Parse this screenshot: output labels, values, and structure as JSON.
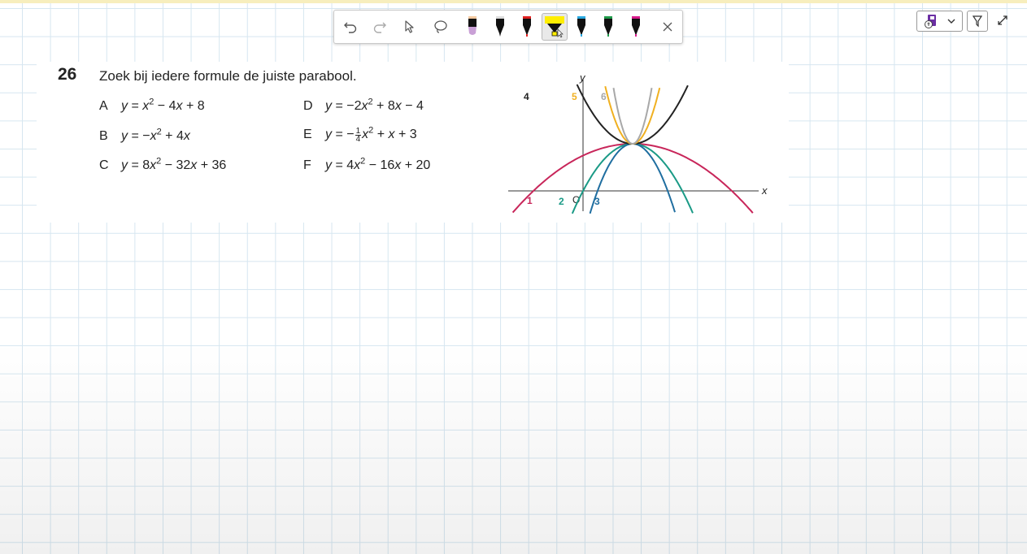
{
  "toolbar": {
    "tools": [
      {
        "name": "undo-icon"
      },
      {
        "name": "redo-icon"
      },
      {
        "name": "select-icon"
      },
      {
        "name": "lasso-icon"
      },
      {
        "name": "pen-purple-icon",
        "color": "#c9a0d6"
      },
      {
        "name": "pen-black-icon",
        "color": "#111111"
      },
      {
        "name": "pen-red-icon",
        "color": "#e02020"
      },
      {
        "name": "highlighter-yellow-icon",
        "color": "#ffee00"
      },
      {
        "name": "pen-blue-icon",
        "color": "#29a8e0"
      },
      {
        "name": "pen-green-icon",
        "color": "#1f9a4a"
      },
      {
        "name": "pen-magenta-icon",
        "color": "#d81b8c"
      },
      {
        "name": "close-icon"
      }
    ]
  },
  "topright": {
    "items": [
      {
        "name": "accessibility-immersive-reader-icon",
        "color": "#6b2ea3"
      },
      {
        "name": "chevron-down-icon"
      },
      {
        "name": "pen-filter-icon"
      },
      {
        "name": "expand-icon"
      }
    ]
  },
  "question": {
    "number": "26",
    "text": "Zoek bij iedere formule de juiste parabool.",
    "options": [
      {
        "letter": "A",
        "formula": "y = x2 − 4x + 8"
      },
      {
        "letter": "B",
        "formula": "y = −x2 + 4x"
      },
      {
        "letter": "C",
        "formula": "y = 8x2 − 32x + 36"
      },
      {
        "letter": "D",
        "formula": "y = −2x2 + 8x − 4"
      },
      {
        "letter": "E",
        "formula": "y = −1/4 x2 + x + 3"
      },
      {
        "letter": "F",
        "formula": "y = 4x2 − 16x + 20"
      }
    ]
  },
  "chart_data": {
    "type": "line",
    "xlabel": "x",
    "ylabel": "y",
    "origin_label": "O",
    "vertex": [
      2,
      4
    ],
    "series": [
      {
        "name": "1",
        "color": "#c8265a",
        "formula": "y = -1/4 x^2 + x + 3"
      },
      {
        "name": "2",
        "color": "#1a9a86",
        "formula": "y = -x^2 + 4x"
      },
      {
        "name": "3",
        "color": "#1f6ea0",
        "formula": "y = -2x^2 + 8x - 4"
      },
      {
        "name": "4",
        "color": "#222222",
        "formula": "y = x^2 - 4x + 8"
      },
      {
        "name": "5",
        "color": "#f0b020",
        "formula": "y = 4x^2 - 16x + 20"
      },
      {
        "name": "6",
        "color": "#a8a8a8",
        "formula": "y = 8x^2 - 32x + 36"
      }
    ]
  }
}
